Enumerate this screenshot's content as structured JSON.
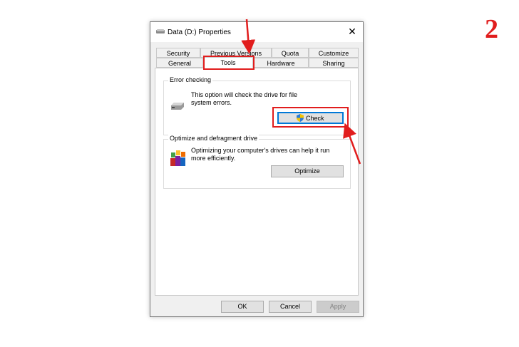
{
  "step_number": "2",
  "window": {
    "title": "Data (D:) Properties",
    "close_label": "✕"
  },
  "tabs_row1": [
    "Security",
    "Previous Versions",
    "Quota",
    "Customize"
  ],
  "tabs_row2": [
    "General",
    "Tools",
    "Hardware",
    "Sharing"
  ],
  "active_tab": "Tools",
  "error_checking": {
    "title": "Error checking",
    "description_line1": "This option will check the drive for file",
    "description_line2": "system errors.",
    "button": "Check"
  },
  "optimize": {
    "title": "Optimize and defragment drive",
    "description_line1": "Optimizing your computer's drives can help it run",
    "description_line2": "more efficiently.",
    "button": "Optimize"
  },
  "footer": {
    "ok": "OK",
    "cancel": "Cancel",
    "apply": "Apply"
  },
  "colors": {
    "highlight": "#e11d1d",
    "focus": "#0078d7",
    "dialog_bg": "#f0f0f0"
  }
}
